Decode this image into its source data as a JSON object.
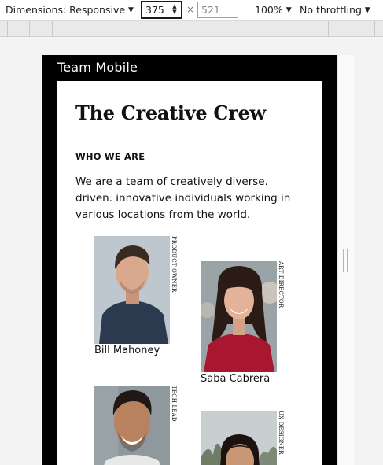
{
  "devtools": {
    "dimensions_label": "Dimensions: Responsive",
    "width_value": "375",
    "height_value": "521",
    "times": "×",
    "zoom_label": "100%",
    "throttle_label": "No throttling"
  },
  "site": {
    "brand": "Team Mobile",
    "title": "The Creative Crew",
    "eyebrow": "WHO WE ARE",
    "lead": "We are a team of creatively diverse. driven. innovative individuals working in various locations from the world."
  },
  "members": [
    {
      "name": "Bill Mahoney",
      "role": "PRODUCT OWNER",
      "shirt": "#2c3a4f",
      "skin": "#d9a88d",
      "hair": "#3a2b22",
      "bg": "#b9c2c8"
    },
    {
      "name": "Saba Cabrera",
      "role": "ART DIRECTOR",
      "shirt": "#a8172e",
      "skin": "#e2b398",
      "hair": "#2a1b16",
      "bg": "#9aa3a6"
    },
    {
      "name": "",
      "role": "TECH LEAD",
      "shirt": "#e8e8e8",
      "skin": "#b9825e",
      "hair": "#1f1814",
      "bg": "#8f989c"
    },
    {
      "name": "",
      "role": "UX DESIGNER",
      "shirt": "#3a3a3a",
      "skin": "#c99774",
      "hair": "#1a1310",
      "bg": "#7d8a78"
    }
  ]
}
